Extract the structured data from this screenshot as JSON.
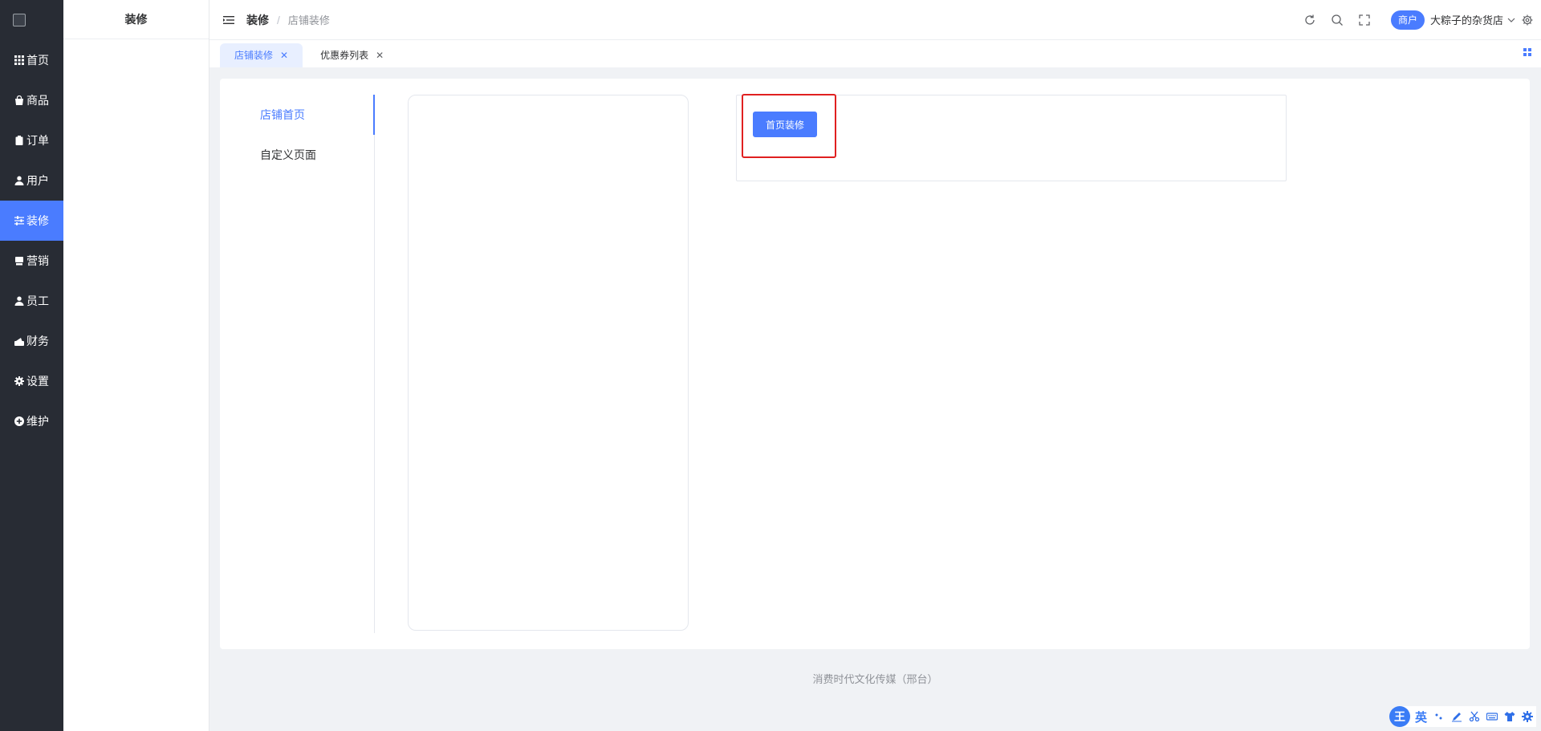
{
  "sidebar": {
    "items": [
      {
        "label": "首页",
        "icon": "grid-icon"
      },
      {
        "label": "商品",
        "icon": "shopping-bag-icon"
      },
      {
        "label": "订单",
        "icon": "clipboard-icon"
      },
      {
        "label": "用户",
        "icon": "user-icon"
      },
      {
        "label": "装修",
        "icon": "sliders-icon",
        "active": true
      },
      {
        "label": "营销",
        "icon": "shop-icon"
      },
      {
        "label": "员工",
        "icon": "person-icon"
      },
      {
        "label": "财务",
        "icon": "wallet-icon"
      },
      {
        "label": "设置",
        "icon": "gear-icon"
      },
      {
        "label": "维护",
        "icon": "plus-circle-icon"
      }
    ]
  },
  "subpanel": {
    "title": "装修"
  },
  "header": {
    "breadcrumb": [
      "装修",
      "店铺装修"
    ],
    "separator": "/",
    "badge": "商户",
    "store_name": "大粽子的杂货店"
  },
  "tabs": [
    {
      "label": "店铺装修",
      "active": true,
      "close": "✕"
    },
    {
      "label": "优惠券列表",
      "active": false,
      "close": "✕"
    }
  ],
  "decor_menu": [
    {
      "label": "店铺首页",
      "active": true
    },
    {
      "label": "自定义页面",
      "active": false
    }
  ],
  "action": {
    "home_decor_button": "首页装修"
  },
  "footer": {
    "text": "消费时代文化传媒（邢台）"
  },
  "ime": {
    "logo": "王",
    "mode": "英"
  },
  "colors": {
    "accent": "#4a7cff",
    "rail": "#282c34",
    "highlight": "#e02020"
  }
}
